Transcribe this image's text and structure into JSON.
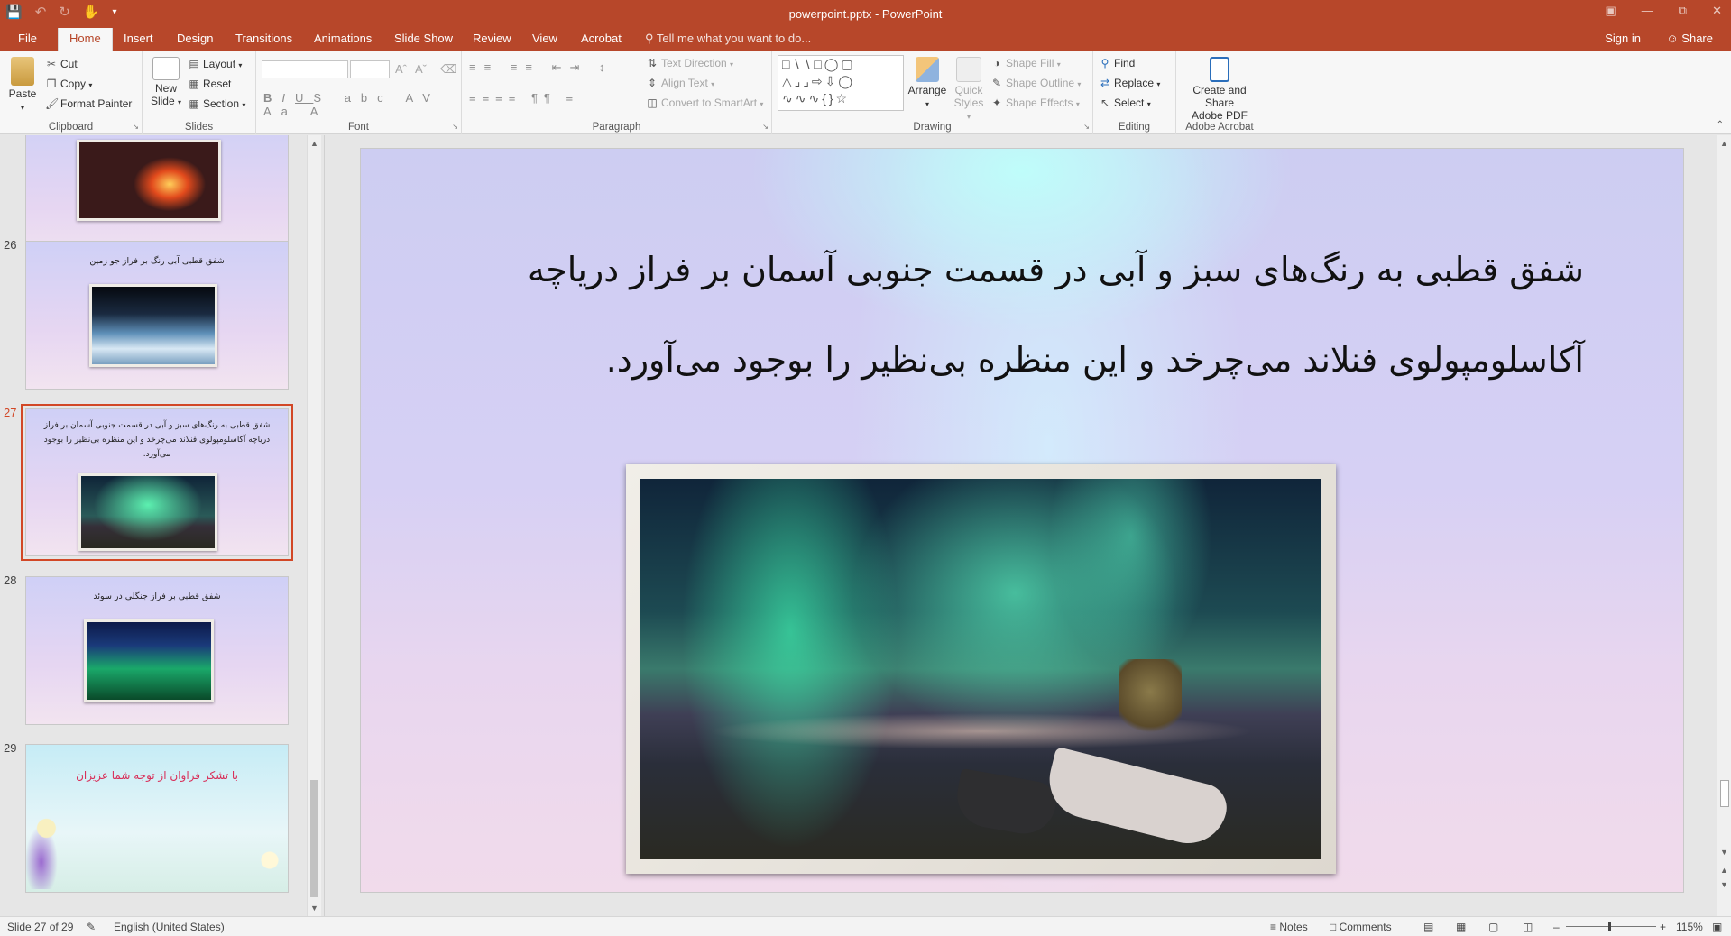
{
  "titlebar": {
    "title": "powerpoint.pptx - PowerPoint",
    "qat_icons": [
      "save-icon",
      "undo-icon",
      "redo-icon",
      "touch-mode-icon",
      "customize-icon"
    ]
  },
  "tabs": {
    "file": "File",
    "home": "Home",
    "insert": "Insert",
    "design": "Design",
    "transitions": "Transitions",
    "animations": "Animations",
    "slideshow": "Slide Show",
    "review": "Review",
    "view": "View",
    "acrobat": "Acrobat",
    "tellme": "Tell me what you want to do...",
    "signin": "Sign in",
    "share": "Share"
  },
  "ribbon": {
    "clipboard": {
      "label": "Clipboard",
      "paste": "Paste",
      "cut": "Cut",
      "copy": "Copy",
      "format_painter": "Format Painter"
    },
    "slides": {
      "label": "Slides",
      "new_slide": "New",
      "new_slide_2": "Slide",
      "layout": "Layout",
      "reset": "Reset",
      "section": "Section"
    },
    "font": {
      "label": "Font"
    },
    "paragraph": {
      "label": "Paragraph",
      "text_direction": "Text Direction",
      "align_text": "Align Text",
      "convert_smartart": "Convert to SmartArt"
    },
    "drawing": {
      "label": "Drawing",
      "arrange": "Arrange",
      "quick_styles": "Quick",
      "quick_styles_2": "Styles",
      "shape_fill": "Shape Fill",
      "shape_outline": "Shape Outline",
      "shape_effects": "Shape Effects"
    },
    "editing": {
      "label": "Editing",
      "find": "Find",
      "replace": "Replace",
      "select": "Select"
    },
    "acrobat": {
      "label": "Adobe Acrobat",
      "create_share": "Create and Share",
      "create_share_2": "Adobe PDF"
    }
  },
  "thumbnails": [
    {
      "number": "",
      "text": ""
    },
    {
      "number": "26",
      "text": "شفق قطبی آبی رنگ بر فراز جو زمین"
    },
    {
      "number": "27",
      "text": "شفق قطبی به رنگ‌های سبز و آبی در قسمت جنوبی آسمان بر فراز دریاچه آکاسلومپولوی فنلاند می‌چرخد و این منظره بی‌نظیر را بوجود می‌آورد."
    },
    {
      "number": "28",
      "text": "شفق قطبی بر فراز جنگلی در سوئد"
    },
    {
      "number": "29",
      "text": "با تشکر فراوان از توجه شما عزیزان"
    }
  ],
  "slide": {
    "title_line1": "شفق قطبی به رنگ‌های سبز و آبی در قسمت جنوبی آسمان بر فراز دریاچه",
    "title_line2": "آکاسلومپولوی فنلاند می‌چرخد و این منظره بی‌نظیر را بوجود می‌آورد."
  },
  "statusbar": {
    "slide_info": "Slide 27 of 29",
    "language": "English (United States)",
    "notes": "Notes",
    "comments": "Comments",
    "zoom": "115%"
  },
  "colors": {
    "accent": "#b7472a",
    "selected_outline": "#d24726"
  }
}
